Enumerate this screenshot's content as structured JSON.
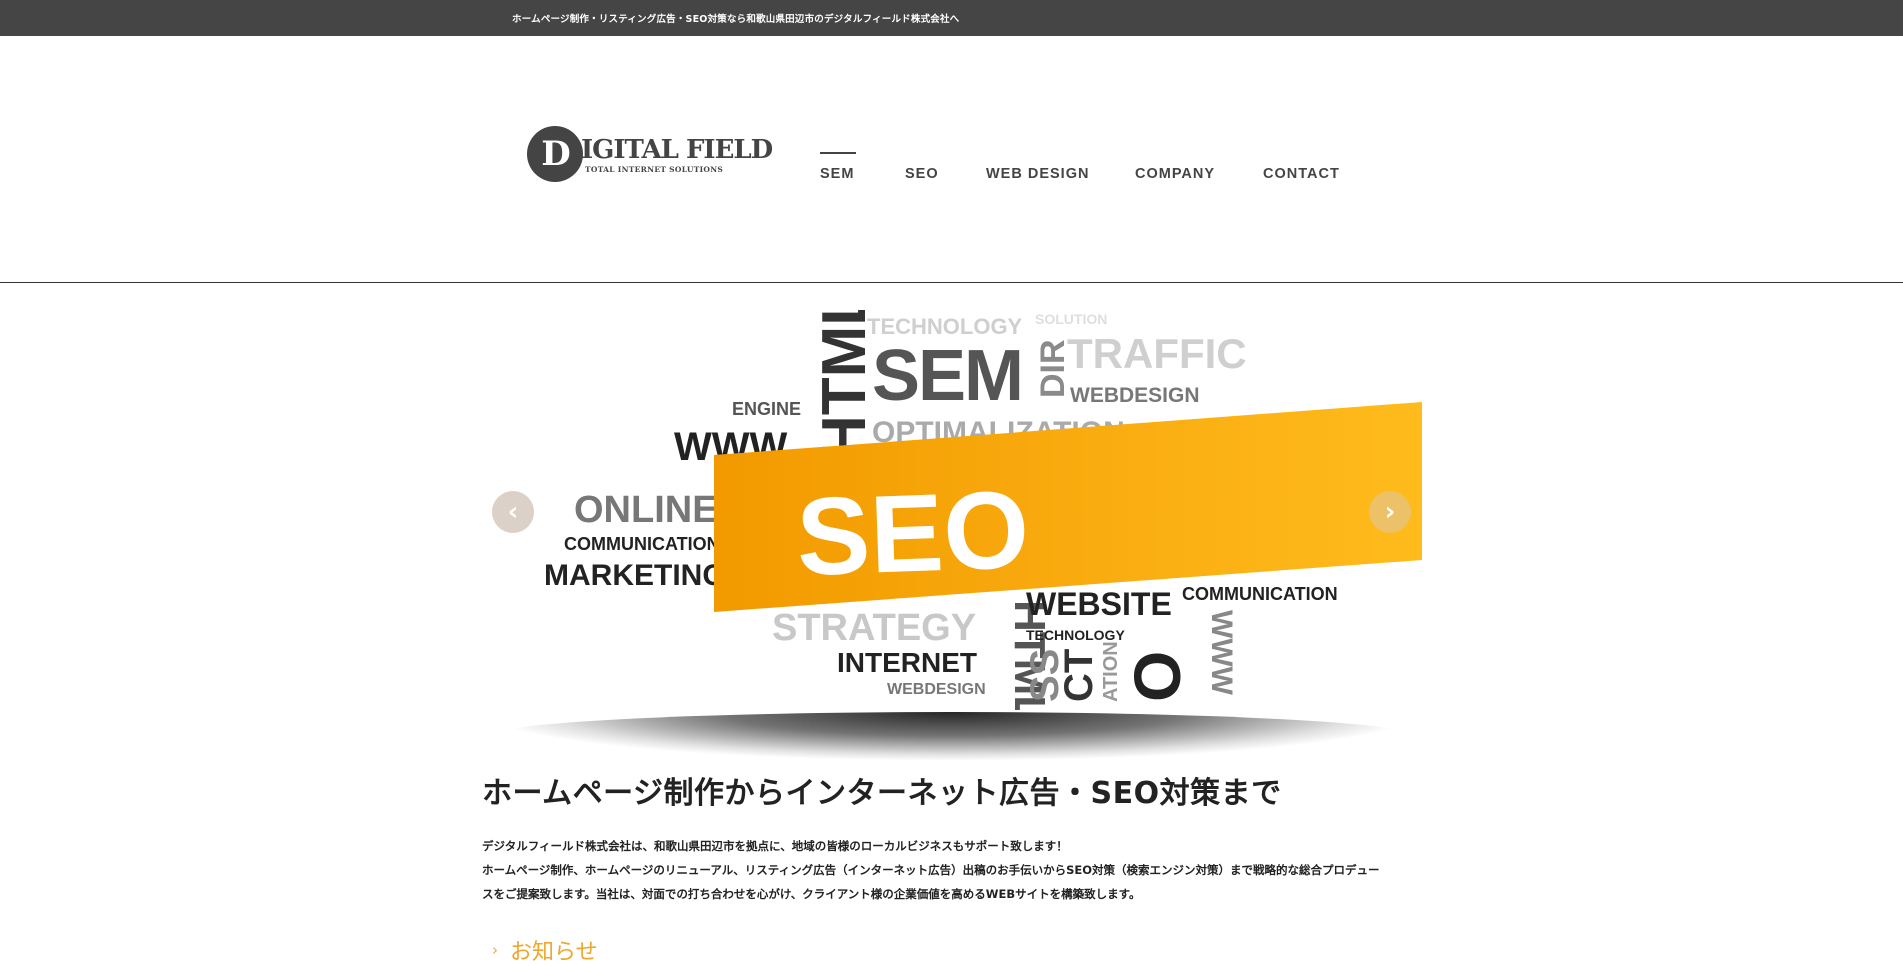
{
  "topbar": {
    "text": "ホームページ制作・リスティング広告・SEO対策なら和歌山県田辺市のデジタルフィールド株式会社へ"
  },
  "logo": {
    "letter": "D",
    "title": "IGITAL FIELD",
    "subtitle": "TOTAL INTERNET SOLUTIONS"
  },
  "nav": {
    "items": [
      {
        "label": "SEM",
        "active": true
      },
      {
        "label": "SEO"
      },
      {
        "label": "WEB DESIGN"
      },
      {
        "label": "COMPANY"
      },
      {
        "label": "CONTACT"
      }
    ]
  },
  "slider": {
    "banner_text": "SEO",
    "words": [
      "TECHNOLOGY",
      "SEM",
      "DIR",
      "TRAFFIC",
      "WEBDESIGN",
      "HTML",
      "ENGINE",
      "WWW",
      "OPTIMALIZATION",
      "ONLINE",
      "COMMUNICATION",
      "MARKETING",
      "STRATEGY",
      "INTERNET",
      "WEBDESIGN",
      "HTML",
      "WEBSITE",
      "TECHNOLOGY",
      "COMMUNICATION",
      "SS",
      "CT",
      "ATION",
      "O",
      "WWW",
      "SOLUTION"
    ],
    "banner_color": "#f7a800",
    "prev_icon": "chevron-left-icon",
    "next_icon": "chevron-right-icon"
  },
  "content": {
    "headline": "ホームページ制作からインターネット広告・SEO対策まで",
    "intro_lines": [
      "デジタルフィールド株式会社は、和歌山県田辺市を拠点に、地域の皆様のローカルビジネスもサポート致します！",
      "ホームページ制作、ホームページのリニューアル、リスティング広告（インターネット広告）出稿のお手伝いからSEO対策（検索エンジン対策）まで戦略的な総合プロデュー",
      "スをご提案致します。当社は、対面での打ち合わせを心がけ、クライアント様の企業価値を高めるWEBサイトを構築致します。"
    ],
    "news_label": "お知らせ",
    "news_icon": "chevron-right-icon"
  },
  "colors": {
    "topbar": "#454545",
    "accent": "#f0a62a"
  }
}
